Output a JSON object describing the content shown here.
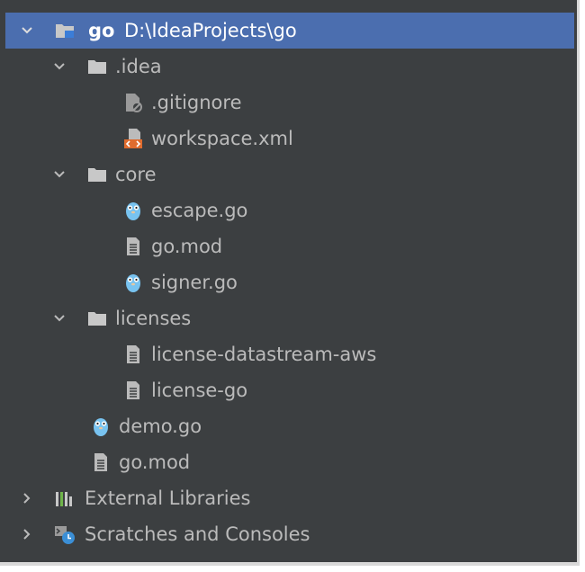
{
  "project": {
    "name": "go",
    "path": "D:\\IdeaProjects\\go"
  },
  "tree": {
    "idea": {
      "label": ".idea"
    },
    "gitignore": {
      "label": ".gitignore"
    },
    "workspace": {
      "label": "workspace.xml"
    },
    "core": {
      "label": "core"
    },
    "escape": {
      "label": "escape.go"
    },
    "core_gomod": {
      "label": "go.mod"
    },
    "signer": {
      "label": "signer.go"
    },
    "licenses": {
      "label": "licenses"
    },
    "license_ds": {
      "label": "license-datastream-aws"
    },
    "license_go": {
      "label": "license-go"
    },
    "demo": {
      "label": "demo.go"
    },
    "root_gomod": {
      "label": "go.mod"
    },
    "external": {
      "label": "External Libraries"
    },
    "scratches": {
      "label": "Scratches and Consoles"
    }
  },
  "icons": {
    "folder": "folder-icon",
    "file_text": "text-file-icon",
    "gopher": "go-file-icon",
    "xml": "xml-file-icon",
    "ignored": "ignore-file-icon",
    "libraries": "libraries-icon",
    "scratches": "scratches-icon"
  },
  "colors": {
    "background": "#3c3f41",
    "selection": "#4b6eaf",
    "text": "#bbbbbb",
    "folder": "#c8c8c8",
    "gopher": "#78c3f0",
    "xml": "#e06c2e"
  }
}
